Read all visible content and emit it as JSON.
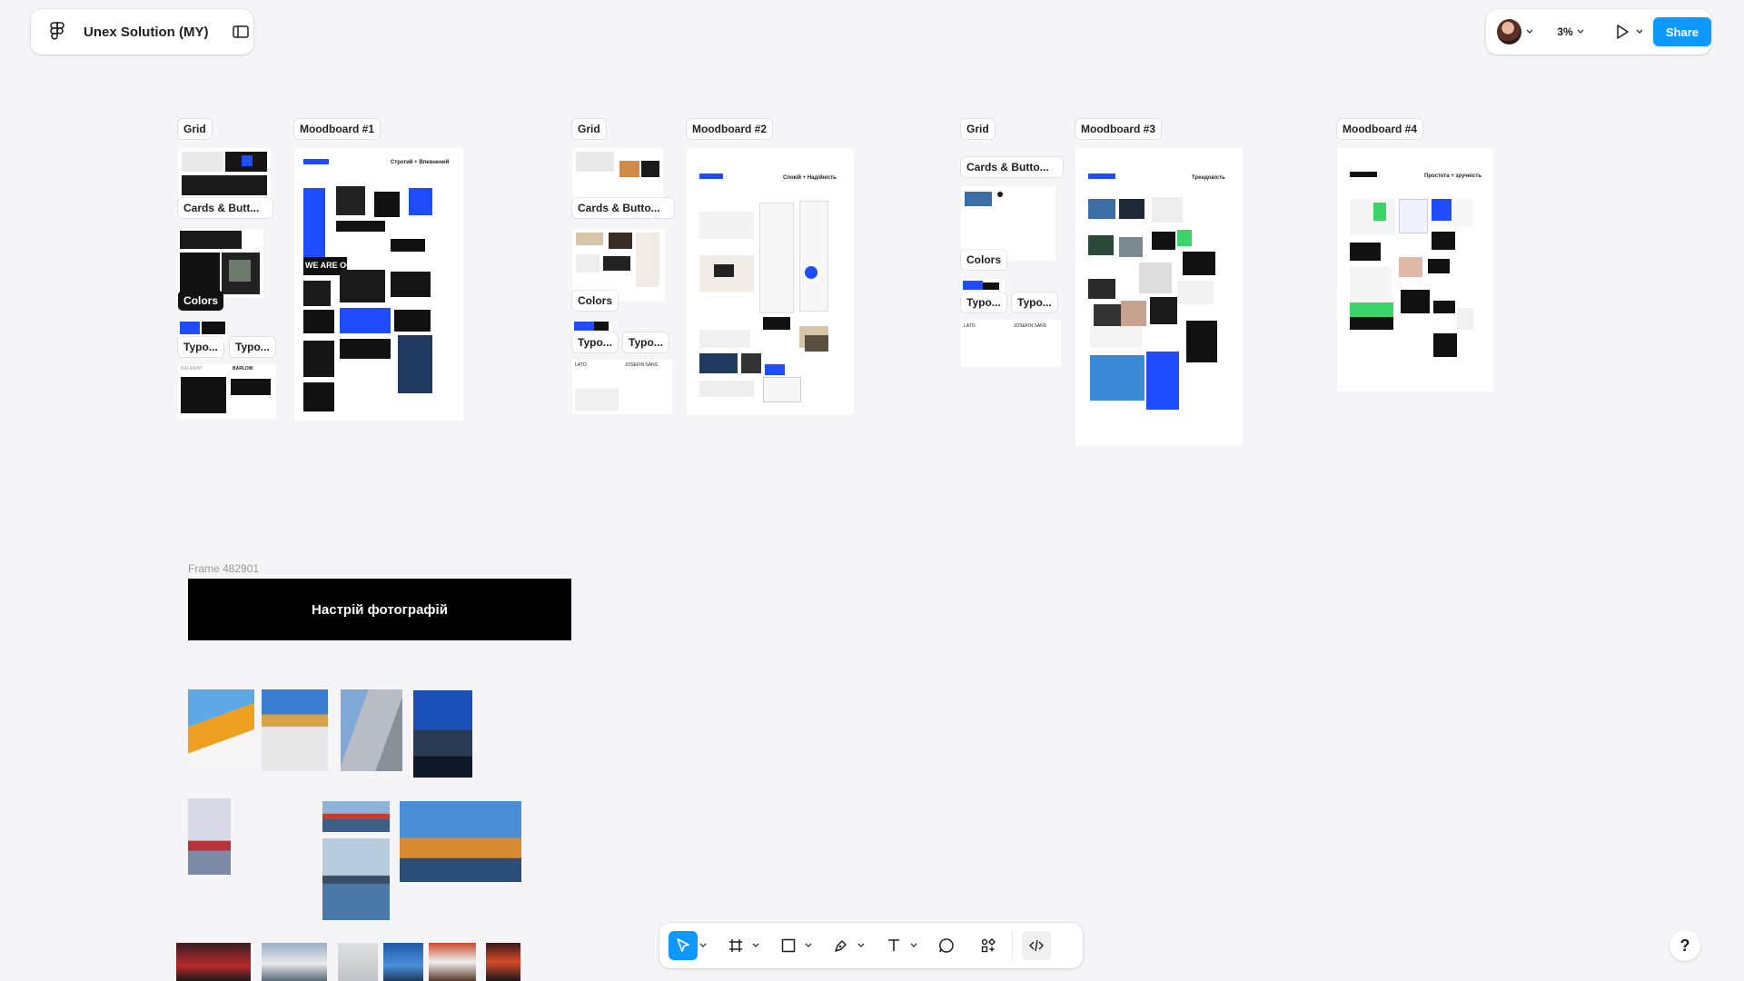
{
  "file": {
    "name": "Unex Solution (MY)"
  },
  "toolbar_right": {
    "zoom": "3%",
    "share_label": "Share"
  },
  "labels": {
    "grid": "Grid",
    "cards": "Cards & Butt...",
    "cards2": "Cards & Butto...",
    "colors": "Colors",
    "typo": "Typo...",
    "mood1": "Moodboard #1",
    "mood2": "Moodboard #2",
    "mood3": "Moodboard #3",
    "mood4": "Moodboard #4"
  },
  "thumb_text": {
    "m1_title": "Строгий + Впевнений",
    "m2_title": "Спокій + Надійність",
    "m3_title": "Трендовість",
    "m4_title": "Простота + зручність",
    "we_are": "WE ARE OCHI",
    "lato": "LATO",
    "josefin": "JOSEFIN SANS",
    "raleway": "RALEWAY",
    "barlow": "BARLOW"
  },
  "photo_section": {
    "frame_label": "Frame 482901",
    "banner": "Настрій фотографій"
  },
  "colors": {
    "accent": "#0d99ff",
    "brand_blue": "#1f4cff",
    "canvas": "#f5f4f6"
  },
  "icons": [
    "figma-logo-icon",
    "sidebar-toggle-icon",
    "chevron-down-icon",
    "play-icon",
    "move-tool-icon",
    "frame-tool-icon",
    "rectangle-tool-icon",
    "pen-tool-icon",
    "text-tool-icon",
    "comment-tool-icon",
    "components-icon",
    "dev-mode-icon",
    "help-icon"
  ]
}
